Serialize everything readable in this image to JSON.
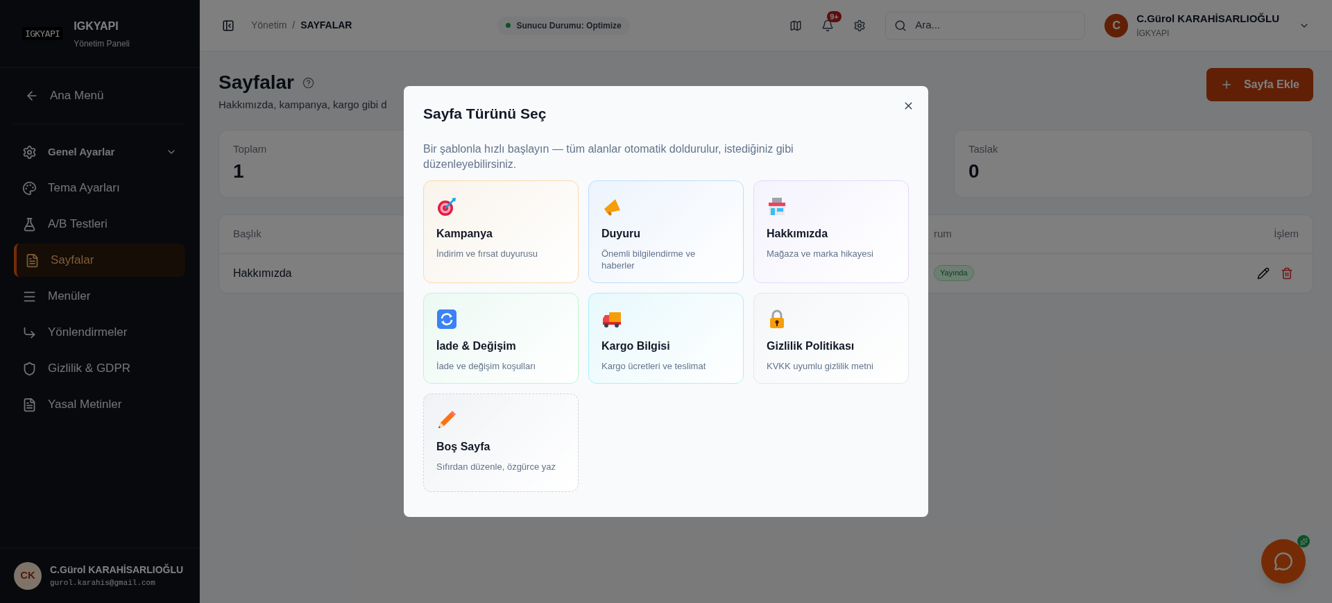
{
  "sidebar": {
    "logo": "IGKYAPI",
    "name": "IGKYAPI",
    "subtitle": "Yönetim Paneli",
    "back": "Ana Menü",
    "items": [
      {
        "label": "Genel Ayarlar",
        "kind": "group",
        "selected": false
      },
      {
        "label": "Tema Ayarları",
        "kind": "link",
        "selected": false
      },
      {
        "label": "A/B Testleri",
        "kind": "link",
        "selected": false
      },
      {
        "label": "Sayfalar",
        "kind": "link",
        "selected": true
      },
      {
        "label": "Menüler",
        "kind": "link",
        "selected": false
      },
      {
        "label": "Yönlendirmeler",
        "kind": "link",
        "selected": false
      },
      {
        "label": "Gizlilik & GDPR",
        "kind": "link",
        "selected": false
      },
      {
        "label": "Yasal Metinler",
        "kind": "link",
        "selected": false
      }
    ],
    "user": {
      "initials": "CK",
      "name": "C.Gürol KARAHİSARLIOĞLU",
      "email": "gurol.karahis@gmail.com"
    }
  },
  "header": {
    "breadcrumb": [
      "Yönetim",
      "SAYFALAR"
    ],
    "breadcrumb_separator": "/",
    "status": "Sunucu Durumu: Optimize",
    "notifications_badge": "9+",
    "search": {
      "placeholder": "Ara..."
    },
    "user": {
      "initial": "C",
      "name": "C.Gürol KARAHİSARLIOĞLU",
      "org": "İGKYAPI"
    }
  },
  "page": {
    "title": "Sayfalar",
    "subtitle": "Hakkımızda, kampanya, kargo gibi d",
    "add_button": "Sayfa Ekle",
    "stats": [
      {
        "label": "Toplam",
        "value": "1"
      },
      {
        "label": "Taslak",
        "value": "0"
      }
    ],
    "table": {
      "columns": [
        "Başlık",
        "rum",
        "İşlem"
      ],
      "rows": [
        {
          "title": "Hakkımızda",
          "status": "Yayında"
        }
      ]
    }
  },
  "modal": {
    "title": "Sayfa Türünü Seç",
    "description": "Bir şablonla hızlı başlayın — tüm alanlar otomatik doldurulur, istediğiniz gibi düzenleyebilirsiniz.",
    "templates": [
      {
        "title": "Kampanya",
        "description": "İndirim ve fırsat duyurusu",
        "kind": "template",
        "color": "#fdd9a8"
      },
      {
        "title": "Duyuru",
        "description": "Önemli bilgilendirme ve haberler",
        "kind": "template",
        "color": "#bfdbfe"
      },
      {
        "title": "Hakkımızda",
        "description": "Mağaza ve marka hikayesi",
        "kind": "template",
        "color": "#e9d5ff"
      },
      {
        "title": "İade & Değişim",
        "description": "İade ve değişim koşulları",
        "kind": "template",
        "color": "#bbf7d0"
      },
      {
        "title": "Kargo Bilgisi",
        "description": "Kargo ücretleri ve teslimat",
        "kind": "template",
        "color": "#a5f3fc"
      },
      {
        "title": "Gizlilik Politikası",
        "description": "KVKK uyumlu gizlilik metni",
        "kind": "template",
        "color": "#e5e7eb"
      },
      {
        "title": "Boş Sayfa",
        "description": "Sıfırdan düzenle, özgürce yaz",
        "kind": "blank",
        "color": "#d1d5db"
      }
    ]
  }
}
